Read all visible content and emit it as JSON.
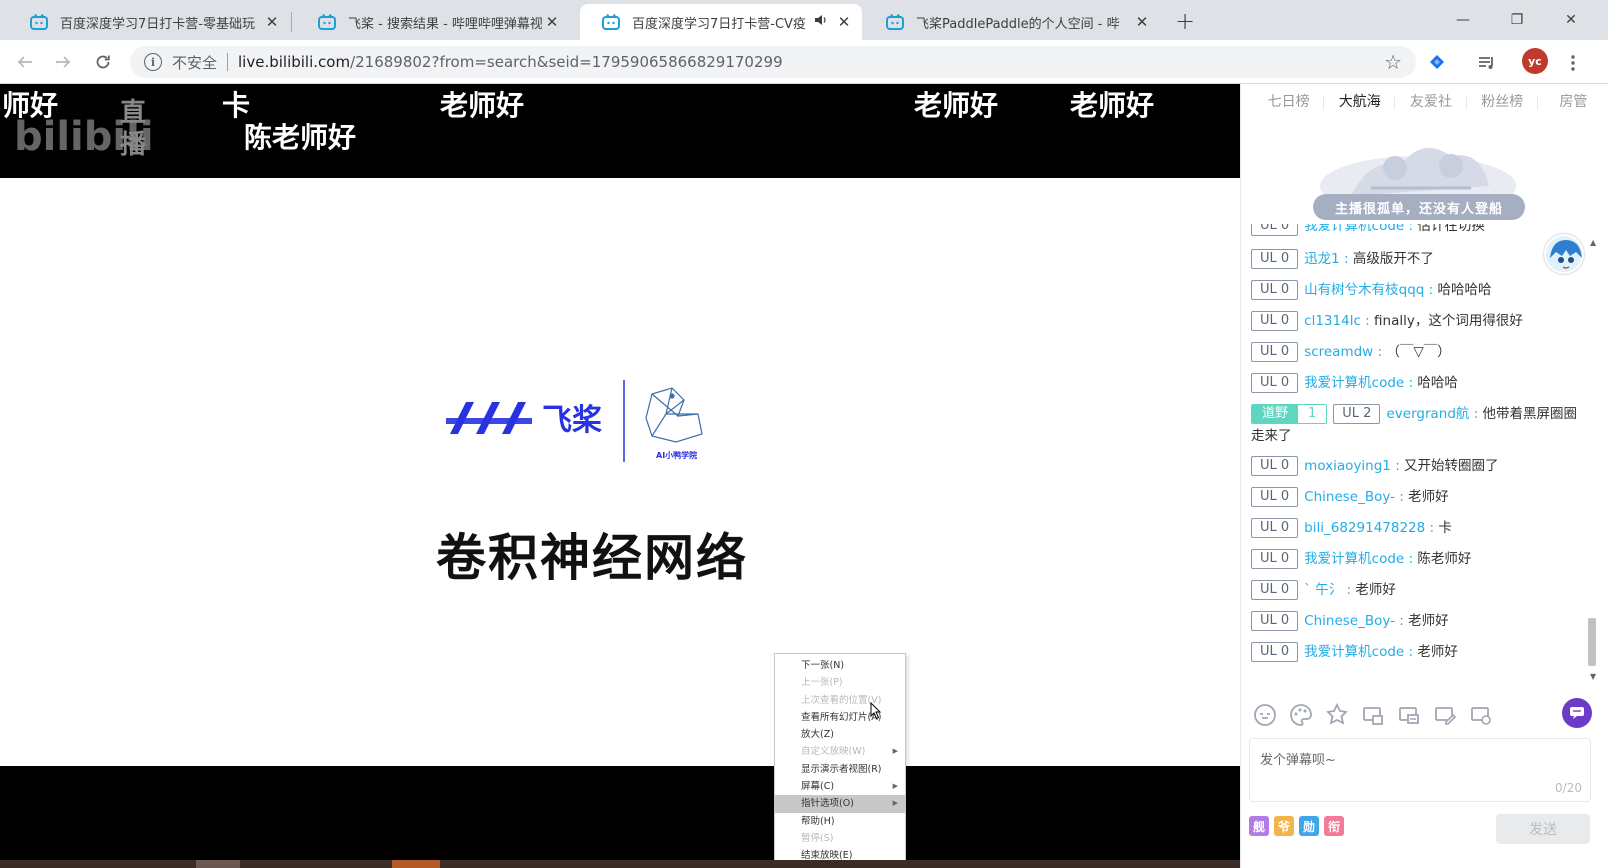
{
  "browser": {
    "tabs": [
      {
        "title": "百度深度学习7日打卡营-零基础玩",
        "active": false,
        "speaker": false
      },
      {
        "title": "飞桨 - 搜索结果 - 哔哩哔哩弹幕视",
        "active": false,
        "speaker": false
      },
      {
        "title": "百度深度学习7日打卡营-CV疫",
        "active": true,
        "speaker": true
      },
      {
        "title": "飞桨PaddlePaddle的个人空间 - 哔",
        "active": false,
        "speaker": false
      }
    ],
    "close_glyph": "✕",
    "new_tab_glyph": "+",
    "window_controls": {
      "minimize": "—",
      "restore": "❐",
      "close": "✕"
    },
    "address": {
      "security_label": "不安全",
      "host": "live.bilibili.com",
      "path": "/21689802?from=search&seid=17959065866829170299"
    },
    "profile_initials": "yc"
  },
  "video": {
    "danmaku": [
      {
        "text": "师好"
      },
      {
        "text": "卡"
      },
      {
        "text": "老师好"
      },
      {
        "text": "陈老师好"
      },
      {
        "text": "老师好"
      },
      {
        "text": "老师好"
      }
    ],
    "watermark_text": {
      "line1": "直",
      "line2": "播"
    },
    "slide": {
      "logo_text": "飞桨",
      "logo_sub": "AI小鸭学院",
      "title": "卷积神经网络"
    },
    "context_menu": [
      {
        "label": "下一张(N)",
        "disabled": false,
        "submenu": false,
        "hover": false
      },
      {
        "label": "上一张(P)",
        "disabled": true,
        "submenu": false,
        "hover": false
      },
      {
        "label": "上次查看的位置(V)",
        "disabled": true,
        "submenu": false,
        "hover": false
      },
      {
        "label": "查看所有幻灯片(A)",
        "disabled": false,
        "submenu": false,
        "hover": false
      },
      {
        "label": "放大(Z)",
        "disabled": false,
        "submenu": false,
        "hover": false
      },
      {
        "label": "自定义放映(W)",
        "disabled": true,
        "submenu": true,
        "hover": false
      },
      {
        "label": "显示演示者视图(R)",
        "disabled": false,
        "submenu": false,
        "hover": false
      },
      {
        "label": "屏幕(C)",
        "disabled": false,
        "submenu": true,
        "hover": false
      },
      {
        "label": "指针选项(O)",
        "disabled": false,
        "submenu": true,
        "hover": true
      },
      {
        "label": "帮助(H)",
        "disabled": false,
        "submenu": false,
        "hover": false
      },
      {
        "label": "暂停(S)",
        "disabled": true,
        "submenu": false,
        "hover": false
      },
      {
        "label": "结束放映(E)",
        "disabled": false,
        "submenu": false,
        "hover": false
      }
    ]
  },
  "panel": {
    "rank_tabs": [
      "七日榜",
      "大航海",
      "友爱社",
      "粉丝榜",
      "房管"
    ],
    "active_rank_tab": 1,
    "empty_message": "主播很孤单，还没有人登船",
    "chat": [
      {
        "ul": "UL 0",
        "user": "我爱计算机code",
        "text": "估计在切换"
      },
      {
        "ul": "UL 0",
        "user": "迅龙1",
        "text": "高级版开不了"
      },
      {
        "ul": "UL 0",
        "user": "山有树兮木有枝qqq",
        "text": "哈哈哈哈"
      },
      {
        "ul": "UL 0",
        "user": "cl1314lc",
        "text": "finally，这个词用得很好"
      },
      {
        "ul": "UL 0",
        "user": "screamdw",
        "text": "（￣▽￣）"
      },
      {
        "ul": "UL 0",
        "user": "我爱计算机code",
        "text": "哈哈哈"
      },
      {
        "ul": "UL 2",
        "user": "evergrand航",
        "text": "他带着黑屏圈圈走来了",
        "medal": {
          "name": "道野",
          "level": "1"
        }
      },
      {
        "ul": "UL 0",
        "user": "moxiaoying1",
        "text": "又开始转圈圈了"
      },
      {
        "ul": "UL 0",
        "user": "Chinese_Boy-",
        "text": "老师好"
      },
      {
        "ul": "UL 0",
        "user": "bili_68291478228",
        "text": "卡"
      },
      {
        "ul": "UL 0",
        "user": "我爱计算机code",
        "text": "陈老师好"
      },
      {
        "ul": "UL 0",
        "user": "ˋ 午氵",
        "text": "老师好"
      },
      {
        "ul": "UL 0",
        "user": "Chinese_Boy-",
        "text": "老师好"
      },
      {
        "ul": "UL 0",
        "user": "我爱计算机code",
        "text": "老师好"
      }
    ],
    "input_placeholder": "发个弹幕呗~",
    "char_counter": "0/20",
    "mini_badges": [
      {
        "label": "舰",
        "color": "#b47be6"
      },
      {
        "label": "爷",
        "color": "#f2b54a"
      },
      {
        "label": "勋",
        "color": "#3fa6ec"
      },
      {
        "label": "衔",
        "color": "#f47a9a"
      }
    ],
    "send_label": "发送"
  },
  "colors": {
    "accent": "#23ade5",
    "medal": "#5fd6c0",
    "profile": "#c0392b"
  }
}
